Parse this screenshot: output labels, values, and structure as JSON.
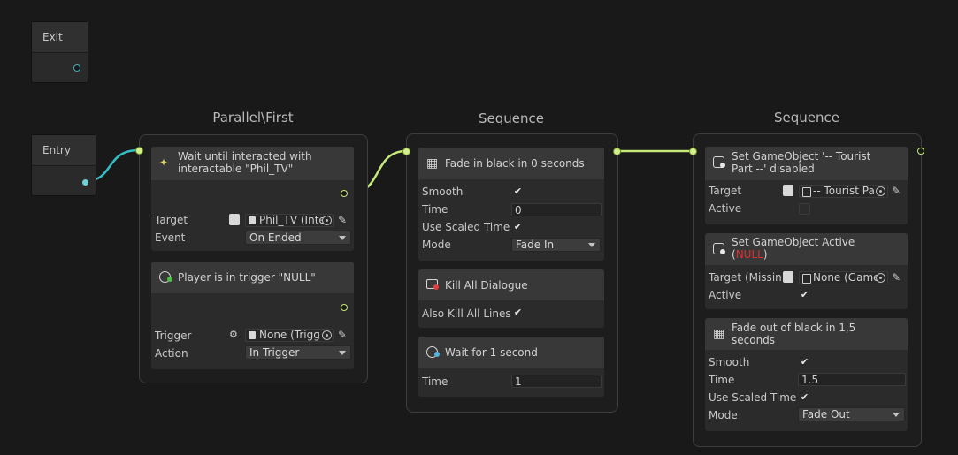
{
  "exit_node": {
    "title": "Exit"
  },
  "entry_node": {
    "title": "Entry"
  },
  "parallel": {
    "title": "Parallel\\First",
    "wait_card": {
      "title_line1": "Wait until interacted with",
      "title_line2": "interactable \"Phil_TV\"",
      "target_label": "Target",
      "target_value": "Phil_TV (Inte",
      "event_label": "Event",
      "event_value": "On Ended"
    },
    "player_card": {
      "title": "Player is in trigger \"NULL\"",
      "trigger_label": "Trigger",
      "trigger_value": "None (Trigg",
      "action_label": "Action",
      "action_value": "In Trigger"
    }
  },
  "sequence1": {
    "title": "Sequence",
    "fade_in_card": {
      "title": "Fade in black in 0 seconds",
      "smooth_label": "Smooth",
      "time_label": "Time",
      "time_value": "0",
      "scaled_label": "Use Scaled Time",
      "mode_label": "Mode",
      "mode_value": "Fade In"
    },
    "kill_card": {
      "title": "Kill All Dialogue",
      "also_label": "Also Kill All Lines"
    },
    "wait_card": {
      "title": "Wait for 1 second",
      "time_label": "Time",
      "time_value": "1"
    }
  },
  "sequence2": {
    "title": "Sequence",
    "set_go_card": {
      "title_line1": "Set GameObject '-- Tourist",
      "title_line2": "Part --' disabled",
      "target_label": "Target",
      "target_value": "-- Tourist Pa",
      "active_label": "Active"
    },
    "set_active_card": {
      "title_line1": "Set GameObject Active",
      "paren_open": "(",
      "null_text": "NULL",
      "paren_close": ")",
      "target_label": "Target (Missin",
      "target_value": "None (Game",
      "active_label": "Active"
    },
    "fade_out_card": {
      "title_line1": "Fade out of black in 1,5",
      "title_line2": "seconds",
      "smooth_label": "Smooth",
      "time_label": "Time",
      "time_value": "1.5",
      "scaled_label": "Use Scaled Time",
      "mode_label": "Mode",
      "mode_value": "Fade Out"
    }
  },
  "colors": {
    "background": "#191919",
    "flow_port": "#c6e879",
    "entry_port": "#38b2b8",
    "null_text": "#e03030"
  },
  "icons": {
    "check": "✔",
    "picker": "eyedropper-icon"
  }
}
